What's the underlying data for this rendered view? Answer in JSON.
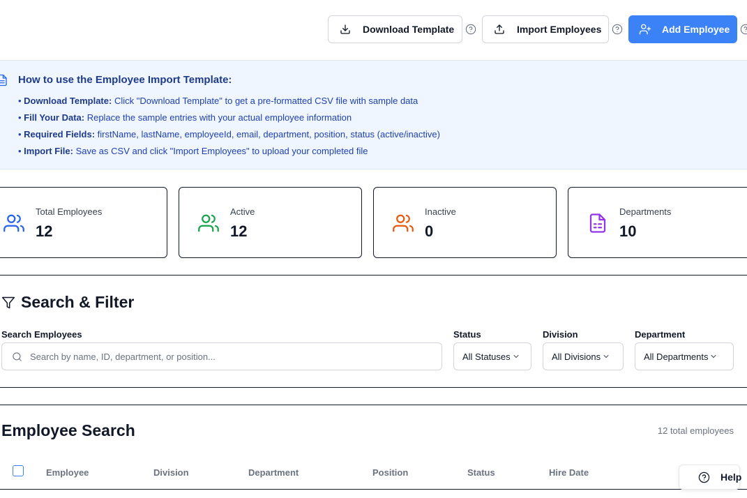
{
  "toolbar": {
    "download_label": "Download Template",
    "import_label": "Import Employees",
    "add_label": "Add Employee",
    "accent_color": "#3b82f6"
  },
  "info": {
    "title": "How to use the Employee Import Template:",
    "items": [
      {
        "bold": "Download Template:",
        "text": " Click \"Download Template\" to get a pre-formatted CSV file with sample data"
      },
      {
        "bold": "Fill Your Data:",
        "text": " Replace the sample entries with your actual employee information"
      },
      {
        "bold": "Required Fields:",
        "text": " firstName, lastName, employeeId, email, department, position, status (active/inactive)"
      },
      {
        "bold": "Import File:",
        "text": " Save as CSV and click \"Import Employees\" to upload your completed file"
      }
    ]
  },
  "stats": [
    {
      "label": "Total Employees",
      "value": "12",
      "icon": "users-icon",
      "color": "#2563eb"
    },
    {
      "label": "Active",
      "value": "12",
      "icon": "users-icon",
      "color": "#16a34a"
    },
    {
      "label": "Inactive",
      "value": "0",
      "icon": "users-icon",
      "color": "#ea580c"
    },
    {
      "label": "Departments",
      "value": "10",
      "icon": "file-text-icon",
      "color": "#9333ea"
    }
  ],
  "filters": {
    "title": "Search & Filter",
    "search_label": "Search Employees",
    "search_placeholder": "Search by name, ID, department, or position...",
    "search_value": "",
    "status_label": "Status",
    "status_value": "All Statuses",
    "division_label": "Division",
    "division_value": "All Divisions",
    "department_label": "Department",
    "department_value": "All Departments"
  },
  "employee_table": {
    "title": "Employee Search",
    "count": "12 total employees",
    "columns": [
      "Employee",
      "Division",
      "Department",
      "Position",
      "Status",
      "Hire Date"
    ]
  },
  "help": {
    "label": "Help"
  }
}
